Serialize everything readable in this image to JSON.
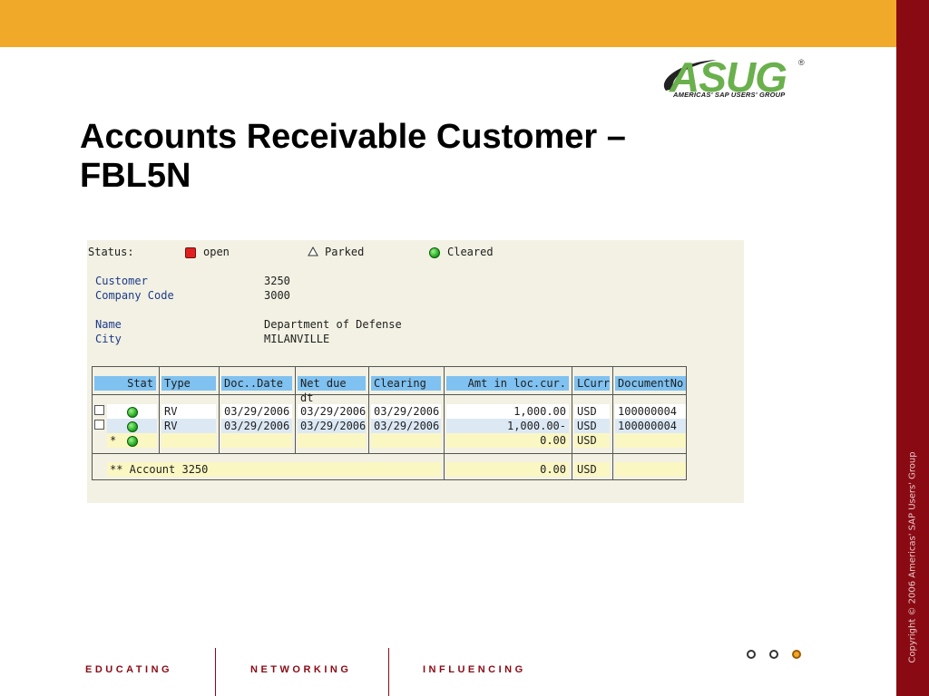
{
  "slide": {
    "title_line1": "Accounts Receivable Customer –",
    "title_line2": "FBL5N",
    "logo": {
      "brand": "ASUG",
      "registered": "®",
      "tagline": "AMERICAS' SAP USERS' GROUP"
    },
    "copyright": "Copyright © 2006 Americas' SAP Users' Group",
    "footer_nav": [
      "EDUCATING",
      "NETWORKING",
      "INFLUENCING"
    ],
    "colors": {
      "top_bar": "#f0a928",
      "side_bar": "#8a0a14",
      "header_cell": "#7fc1f0"
    }
  },
  "sap": {
    "status_label": "Status:",
    "legend": [
      {
        "icon": "open-status-icon",
        "text": "open"
      },
      {
        "icon": "parked-status-icon",
        "text": "Parked"
      },
      {
        "icon": "cleared-status-icon",
        "text": "Cleared"
      }
    ],
    "fields": {
      "customer_label": "Customer",
      "customer_value": "3250",
      "company_label": "Company Code",
      "company_value": "3000",
      "name_label": "Name",
      "name_value": "Department of Defense",
      "city_label": "City",
      "city_value": "MILANVILLE"
    },
    "columns": [
      "Stat",
      "Type",
      "Doc..Date",
      "Net due dt",
      "Clearing",
      "Amt in loc.cur.",
      "LCurr",
      "DocumentNo"
    ],
    "rows": [
      {
        "type": "RV",
        "doc_date": "03/29/2006",
        "net_due": "03/29/2006",
        "clearing": "03/29/2006",
        "amount": "1,000.00",
        "curr": "USD",
        "doc_no": "100000004"
      },
      {
        "type": "RV",
        "doc_date": "03/29/2006",
        "net_due": "03/29/2006",
        "clearing": "03/29/2006",
        "amount": "1,000.00-",
        "curr": "USD",
        "doc_no": "100000004"
      }
    ],
    "subtotal": {
      "marker": "*",
      "amount": "0.00",
      "curr": "USD"
    },
    "total": {
      "label": "** Account 3250",
      "amount": "0.00",
      "curr": "USD"
    }
  }
}
